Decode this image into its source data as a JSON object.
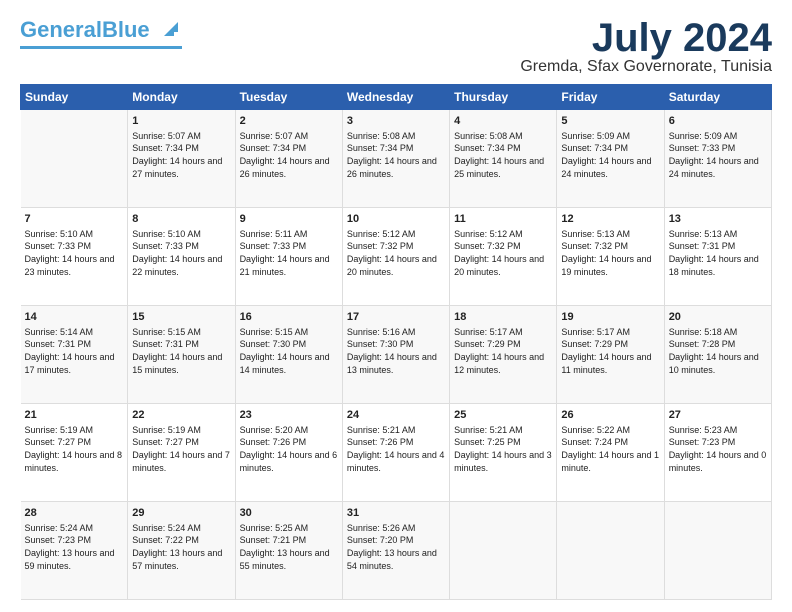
{
  "header": {
    "logo_general": "General",
    "logo_blue": "Blue",
    "title": "July 2024",
    "subtitle": "Gremda, Sfax Governorate, Tunisia"
  },
  "columns": [
    "Sunday",
    "Monday",
    "Tuesday",
    "Wednesday",
    "Thursday",
    "Friday",
    "Saturday"
  ],
  "weeks": [
    [
      {
        "day": "",
        "sunrise": "",
        "sunset": "",
        "daylight": ""
      },
      {
        "day": "1",
        "sunrise": "5:07 AM",
        "sunset": "7:34 PM",
        "daylight": "14 hours and 27 minutes."
      },
      {
        "day": "2",
        "sunrise": "5:07 AM",
        "sunset": "7:34 PM",
        "daylight": "14 hours and 26 minutes."
      },
      {
        "day": "3",
        "sunrise": "5:08 AM",
        "sunset": "7:34 PM",
        "daylight": "14 hours and 26 minutes."
      },
      {
        "day": "4",
        "sunrise": "5:08 AM",
        "sunset": "7:34 PM",
        "daylight": "14 hours and 25 minutes."
      },
      {
        "day": "5",
        "sunrise": "5:09 AM",
        "sunset": "7:34 PM",
        "daylight": "14 hours and 24 minutes."
      },
      {
        "day": "6",
        "sunrise": "5:09 AM",
        "sunset": "7:33 PM",
        "daylight": "14 hours and 24 minutes."
      }
    ],
    [
      {
        "day": "7",
        "sunrise": "5:10 AM",
        "sunset": "7:33 PM",
        "daylight": "14 hours and 23 minutes."
      },
      {
        "day": "8",
        "sunrise": "5:10 AM",
        "sunset": "7:33 PM",
        "daylight": "14 hours and 22 minutes."
      },
      {
        "day": "9",
        "sunrise": "5:11 AM",
        "sunset": "7:33 PM",
        "daylight": "14 hours and 21 minutes."
      },
      {
        "day": "10",
        "sunrise": "5:12 AM",
        "sunset": "7:32 PM",
        "daylight": "14 hours and 20 minutes."
      },
      {
        "day": "11",
        "sunrise": "5:12 AM",
        "sunset": "7:32 PM",
        "daylight": "14 hours and 20 minutes."
      },
      {
        "day": "12",
        "sunrise": "5:13 AM",
        "sunset": "7:32 PM",
        "daylight": "14 hours and 19 minutes."
      },
      {
        "day": "13",
        "sunrise": "5:13 AM",
        "sunset": "7:31 PM",
        "daylight": "14 hours and 18 minutes."
      }
    ],
    [
      {
        "day": "14",
        "sunrise": "5:14 AM",
        "sunset": "7:31 PM",
        "daylight": "14 hours and 17 minutes."
      },
      {
        "day": "15",
        "sunrise": "5:15 AM",
        "sunset": "7:31 PM",
        "daylight": "14 hours and 15 minutes."
      },
      {
        "day": "16",
        "sunrise": "5:15 AM",
        "sunset": "7:30 PM",
        "daylight": "14 hours and 14 minutes."
      },
      {
        "day": "17",
        "sunrise": "5:16 AM",
        "sunset": "7:30 PM",
        "daylight": "14 hours and 13 minutes."
      },
      {
        "day": "18",
        "sunrise": "5:17 AM",
        "sunset": "7:29 PM",
        "daylight": "14 hours and 12 minutes."
      },
      {
        "day": "19",
        "sunrise": "5:17 AM",
        "sunset": "7:29 PM",
        "daylight": "14 hours and 11 minutes."
      },
      {
        "day": "20",
        "sunrise": "5:18 AM",
        "sunset": "7:28 PM",
        "daylight": "14 hours and 10 minutes."
      }
    ],
    [
      {
        "day": "21",
        "sunrise": "5:19 AM",
        "sunset": "7:27 PM",
        "daylight": "14 hours and 8 minutes."
      },
      {
        "day": "22",
        "sunrise": "5:19 AM",
        "sunset": "7:27 PM",
        "daylight": "14 hours and 7 minutes."
      },
      {
        "day": "23",
        "sunrise": "5:20 AM",
        "sunset": "7:26 PM",
        "daylight": "14 hours and 6 minutes."
      },
      {
        "day": "24",
        "sunrise": "5:21 AM",
        "sunset": "7:26 PM",
        "daylight": "14 hours and 4 minutes."
      },
      {
        "day": "25",
        "sunrise": "5:21 AM",
        "sunset": "7:25 PM",
        "daylight": "14 hours and 3 minutes."
      },
      {
        "day": "26",
        "sunrise": "5:22 AM",
        "sunset": "7:24 PM",
        "daylight": "14 hours and 1 minute."
      },
      {
        "day": "27",
        "sunrise": "5:23 AM",
        "sunset": "7:23 PM",
        "daylight": "14 hours and 0 minutes."
      }
    ],
    [
      {
        "day": "28",
        "sunrise": "5:24 AM",
        "sunset": "7:23 PM",
        "daylight": "13 hours and 59 minutes."
      },
      {
        "day": "29",
        "sunrise": "5:24 AM",
        "sunset": "7:22 PM",
        "daylight": "13 hours and 57 minutes."
      },
      {
        "day": "30",
        "sunrise": "5:25 AM",
        "sunset": "7:21 PM",
        "daylight": "13 hours and 55 minutes."
      },
      {
        "day": "31",
        "sunrise": "5:26 AM",
        "sunset": "7:20 PM",
        "daylight": "13 hours and 54 minutes."
      },
      {
        "day": "",
        "sunrise": "",
        "sunset": "",
        "daylight": ""
      },
      {
        "day": "",
        "sunrise": "",
        "sunset": "",
        "daylight": ""
      },
      {
        "day": "",
        "sunrise": "",
        "sunset": "",
        "daylight": ""
      }
    ]
  ]
}
